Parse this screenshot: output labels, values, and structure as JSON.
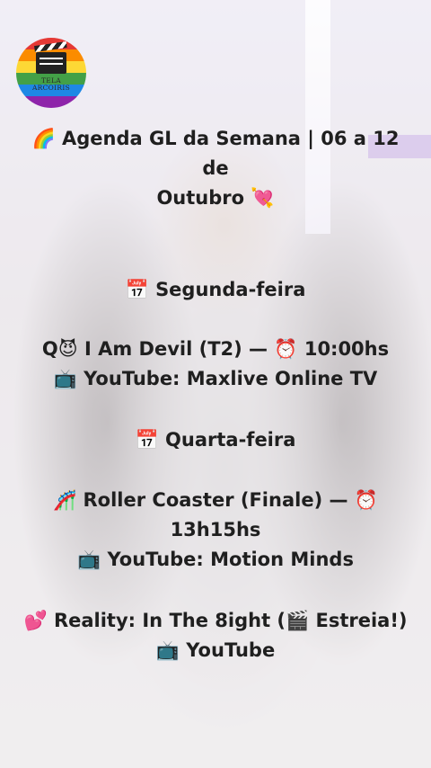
{
  "logo": {
    "line1": "TELA",
    "line2": "ARCOIRIS"
  },
  "title": {
    "emoji_start": "🌈",
    "line1": "Agenda GL da Semana | 06 a 12 de",
    "line2": "Outubro",
    "emoji_end": "💘"
  },
  "days": [
    {
      "emoji": "📅",
      "label": "Segunda-feira",
      "shows": [
        {
          "lead": "Q",
          "lead_emoji": "😈",
          "title": "I Am Devil (T2) —",
          "time_emoji": "⏰",
          "time": "10:00hs",
          "platform_emoji": "📺",
          "platform": "YouTube: Maxlive Online TV"
        }
      ]
    },
    {
      "emoji": "📅",
      "label": "Quarta-feira",
      "shows": [
        {
          "lead_emoji": "🎢",
          "title": "Roller Coaster (Finale) —",
          "time_emoji": "⏰",
          "time": "13h15hs",
          "platform_emoji": "📺",
          "platform": "YouTube: Motion Minds"
        },
        {
          "lead_emoji": "💕",
          "title": "Reality: In The 8ight (",
          "badge_emoji": "🎬",
          "badge": "Estreia!)",
          "platform_emoji": "📺",
          "platform": "YouTube"
        }
      ]
    }
  ]
}
